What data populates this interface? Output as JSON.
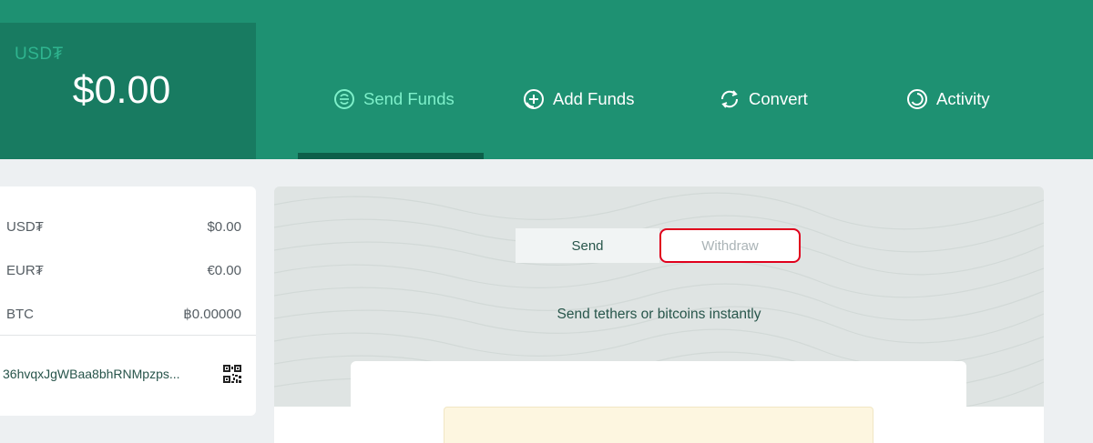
{
  "balance": {
    "currency": "USD₮",
    "amount": "$0.00"
  },
  "nav": {
    "items": [
      {
        "label": "Send Funds",
        "icon": "send-funds-icon",
        "active": true
      },
      {
        "label": "Add Funds",
        "icon": "add-funds-icon",
        "active": false
      },
      {
        "label": "Convert",
        "icon": "convert-icon",
        "active": false
      },
      {
        "label": "Activity",
        "icon": "activity-icon",
        "active": false
      }
    ]
  },
  "accounts": [
    {
      "currency": "USD₮",
      "balance": "$0.00"
    },
    {
      "currency": "EUR₮",
      "balance": "€0.00"
    },
    {
      "currency": "BTC",
      "balance": "฿0.00000"
    }
  ],
  "address": {
    "value": "36hvqxJgWBaa8bhRNMpzps...",
    "icon": "qr-code-icon"
  },
  "send_panel": {
    "tabs": [
      {
        "label": "Send",
        "selected": true
      },
      {
        "label": "Withdraw",
        "selected": false
      }
    ],
    "tagline": "Send tethers or bitcoins instantly"
  },
  "colors": {
    "header": "#1e9172",
    "balance_panel": "#187b61",
    "active_nav": "#7ef0ca",
    "highlight_border": "#e0001c"
  }
}
